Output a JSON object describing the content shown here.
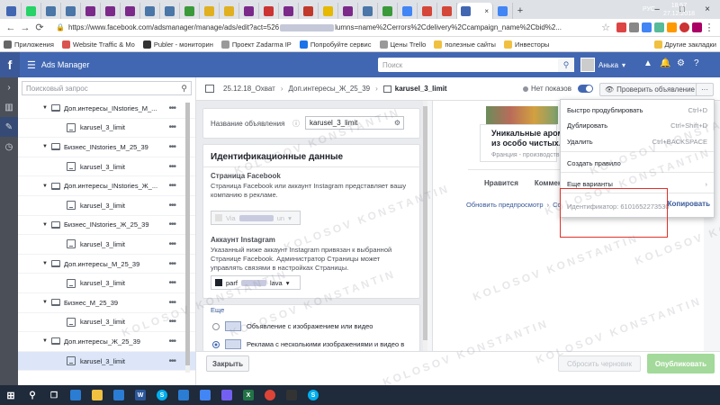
{
  "browser": {
    "tabs": [
      {
        "icon": "blue-square",
        "color": "#4267b2"
      },
      {
        "icon": "green-circle",
        "color": "#25d366"
      },
      {
        "icon": "vk",
        "color": "#4a76a8"
      },
      {
        "icon": "vk",
        "color": "#4a76a8"
      },
      {
        "icon": "purple-square",
        "color": "#7b2a8a"
      },
      {
        "icon": "purple-square",
        "color": "#7b2a8a"
      },
      {
        "icon": "purple-square",
        "color": "#7b2a8a"
      },
      {
        "icon": "vk",
        "color": "#4a76a8"
      },
      {
        "icon": "vk",
        "color": "#4a76a8"
      },
      {
        "icon": "green-square",
        "color": "#3a9a3a"
      },
      {
        "icon": "yellow-cone",
        "color": "#e0b020"
      },
      {
        "icon": "yellow-cone",
        "color": "#e0b020"
      },
      {
        "icon": "purple-square",
        "color": "#7b2a8a"
      },
      {
        "icon": "d-letter",
        "color": "#cc3333"
      },
      {
        "icon": "purple-square",
        "color": "#7b2a8a"
      },
      {
        "icon": "red-square",
        "color": "#c0392b"
      },
      {
        "icon": "yellow-sun",
        "color": "#e6b800"
      },
      {
        "icon": "purple-square",
        "color": "#7b2a8a"
      },
      {
        "icon": "vk",
        "color": "#4a76a8"
      },
      {
        "icon": "green-square",
        "color": "#3a9a3a"
      },
      {
        "icon": "google",
        "color": "#4285f4"
      },
      {
        "icon": "gmail",
        "color": "#d44638"
      },
      {
        "icon": "gmail",
        "color": "#d44638"
      },
      {
        "icon": "active-facebook",
        "color": "#4267b2"
      },
      {
        "icon": "google",
        "color": "#4285f4"
      }
    ],
    "address_url": "https://www.facebook.com/adsmanager/manage/ads/edit?act=526",
    "address_url_end": "lumns=name%2Cerrors%2Cdelivery%2Ccampaign_name%2Cbid%2...",
    "bookmarks": [
      {
        "label": "Приложения",
        "color": "#666"
      },
      {
        "label": "Website Traffic & Mo",
        "color": "#d9534f"
      },
      {
        "label": "Publer - мониторин",
        "color": "#333"
      },
      {
        "label": "Проект Zadarma IP",
        "color": "#999"
      },
      {
        "label": "Попробуйте сервис",
        "color": "#1a73e8"
      },
      {
        "label": "Цены Trello",
        "color": "#999"
      },
      {
        "label": "полезные сайты",
        "color": "#f0c040"
      },
      {
        "label": "Инвесторы",
        "color": "#f0c040"
      }
    ],
    "other_bookmarks": "Другие закладки"
  },
  "fb": {
    "app_title": "Ads Manager",
    "search_placeholder": "Поиск",
    "user_name": "Анька"
  },
  "tree": {
    "search_placeholder": "Поисковый запрос",
    "rows": [
      {
        "label": "Доп.интересы_INstories_M_...",
        "type": "adset"
      },
      {
        "label": "karusel_3_limit",
        "type": "ad"
      },
      {
        "label": "Бизнес_INstories_M_25_39",
        "type": "adset"
      },
      {
        "label": "karusel_3_limit",
        "type": "ad"
      },
      {
        "label": "Доп.интересы_INstories_Ж_...",
        "type": "adset"
      },
      {
        "label": "karusel_3_limit",
        "type": "ad"
      },
      {
        "label": "Бизнес_INstories_Ж_25_39",
        "type": "adset"
      },
      {
        "label": "karusel_3_limit",
        "type": "ad"
      },
      {
        "label": "Доп.интересы_M_25_39",
        "type": "adset"
      },
      {
        "label": "karusel_3_limit",
        "type": "ad"
      },
      {
        "label": "Бизнес_M_25_39",
        "type": "adset"
      },
      {
        "label": "karusel_3_limit",
        "type": "ad"
      },
      {
        "label": "Доп.интересы_Ж_25_39",
        "type": "adset"
      },
      {
        "label": "karusel_3_limit",
        "type": "ad",
        "selected": true
      }
    ]
  },
  "editor": {
    "crumb_date": "25.12.18_Охват",
    "crumb_adset": "Доп.интересы_Ж_25_39",
    "crumb_ad": "karusel_3_limit",
    "no_impressions": "Нет показов",
    "check_ad": "Проверить объявление"
  },
  "form": {
    "ad_name_label": "Название объявления",
    "ad_name_value": "karusel_3_limit",
    "identity_title": "Идентификационные данные",
    "fb_page_label": "Страница Facebook",
    "fb_page_desc": "Страница Facebook или аккаунт Instagram представляет вашу компанию в рекламе.",
    "fb_page_value": "Via",
    "fb_page_value_end": "un",
    "ig_label": "Аккаунт Instagram",
    "ig_desc": "Указанный ниже аккаунт Instagram привязан к выбранной Странице Facebook. Администратор Страницы может управлять связями в настройках Страницы.",
    "ig_value": "parf",
    "ig_value_end": "lava",
    "more_link": "Еще",
    "format_single": "Объявление с изображением или видео",
    "format_carousel": "Реклама с несколькими изображениями и видео в"
  },
  "preview": {
    "headline_1": "Уникальные арома",
    "headline_2": "из особо чистых...",
    "sub": "Франция - производств",
    "tab_like": "Нравится",
    "tab_comment": "Комментар",
    "refresh": "Обновить предпросмотр",
    "refresh_end": "Сооб"
  },
  "menu": {
    "items": [
      {
        "label": "Быстро продублировать",
        "shortcut": "Ctrl+D"
      },
      {
        "label": "Дублировать",
        "shortcut": "Ctrl+Shift+D"
      },
      {
        "label": "Удалить",
        "shortcut": "Ctrl+BACKSPACE"
      },
      {
        "label": "Создать правило",
        "shortcut": ""
      },
      {
        "label": "Еще варианты",
        "shortcut": "›"
      }
    ],
    "identifier": "Идентификатор: 6101652273530",
    "copy": "Копировать"
  },
  "actions": {
    "close": "Закрыть",
    "reset": "Сбросить черновик",
    "publish": "Опубликовать"
  },
  "watermark": "KOLOSOV KONSTANTIN",
  "taskbar": {
    "lang": "РУС",
    "time": "18:57",
    "date": "27.12.2018",
    "apps": [
      {
        "icon": "windows-start",
        "color": "#ffffff"
      },
      {
        "icon": "search",
        "color": "#ffffff"
      },
      {
        "icon": "task-view",
        "color": "#ffffff"
      },
      {
        "icon": "edge",
        "color": "#2b7cd3"
      },
      {
        "icon": "file-explorer",
        "color": "#f0c040"
      },
      {
        "icon": "store",
        "color": "#2b7cd3"
      },
      {
        "icon": "word",
        "color": "#2b579a"
      },
      {
        "icon": "skype",
        "color": "#00aff0"
      },
      {
        "icon": "edge",
        "color": "#2b7cd3"
      },
      {
        "icon": "chrome-remote",
        "color": "#4285f4"
      },
      {
        "icon": "viber",
        "color": "#7360f2"
      },
      {
        "icon": "excel",
        "color": "#217346"
      },
      {
        "icon": "chrome",
        "color": "#db4437"
      },
      {
        "icon": "camera",
        "color": "#333"
      },
      {
        "icon": "skype",
        "color": "#00aff0"
      }
    ]
  }
}
